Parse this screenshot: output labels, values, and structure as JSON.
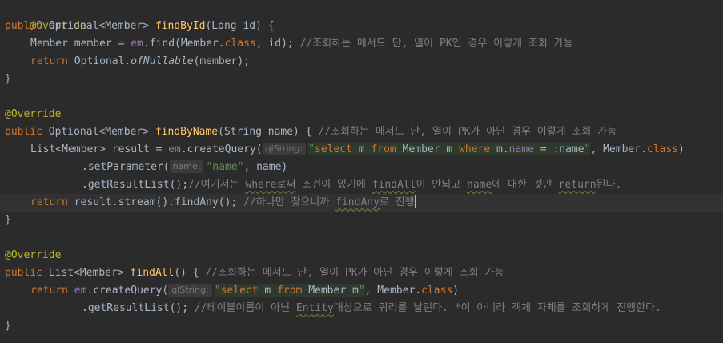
{
  "code": {
    "l1": {
      "ann": "@Override"
    },
    "l2": {
      "public": "public",
      "type": "Optional<Member>",
      "fn": "findById",
      "params": "(Long id) {"
    },
    "l3": {
      "t1": "Member member = ",
      "em": "em",
      "t2": ".find(Member.",
      "cls": "class",
      "t3": ", id);",
      "comment": " //조회하는 메서드 단, 열이 PK인 경우 이렇게 조회 가능"
    },
    "l4": {
      "ret": "return",
      "t1": " Optional.",
      "method": "ofNullable",
      "t2": "(member);"
    },
    "l5": {
      "t": "}"
    },
    "l7": {
      "ann": "@Override"
    },
    "l8": {
      "public": "public",
      "type": "Optional<Member>",
      "fn": "findByName",
      "params": "(String name) {",
      "comment": " //조회하는 메서드 단, 열이 PK가 아닌 경우 이렇게 조회 가능"
    },
    "l9": {
      "t1": "List<Member> result = ",
      "em": "em",
      "t2": ".createQuery(",
      "hint": "qlString:",
      "q1": "\"",
      "select": "select",
      "m1": " m ",
      "from": "from",
      "m2": " Member m ",
      "where": "where",
      "m3": " m.",
      "name": "name",
      "m4": " = :name",
      "q2": "\"",
      "t3": ", Member.",
      "cls": "class",
      "t4": ")"
    },
    "l10": {
      "t1": ".setParameter(",
      "hint": "name:",
      "str": "\"name\"",
      "t2": ", name)"
    },
    "l11": {
      "t1": ".getResultList();",
      "c1": "//여기서는 ",
      "w1": "where로써",
      "c2": " 조건이 있기에 ",
      "w2": "findAll",
      "c3": "이 안되고 ",
      "w3": "name",
      "c4": "에 대한 것만 ",
      "w4": "return",
      "c5": "된다."
    },
    "l12": {
      "ret": "return",
      "t1": " result.stream().findAny();",
      "comment": " //하나만 찾으니까 ",
      "w1": "findAny",
      "c2": "로 진행"
    },
    "l13": {
      "t": "}"
    },
    "l15": {
      "ann": "@Override"
    },
    "l16": {
      "public": "public",
      "type": "List<Member>",
      "fn": "findAll",
      "params": "() {",
      "comment": " //조회하는 메서드 단, 열이 PK가 아닌 경우 이렇게 조회 가능"
    },
    "l17": {
      "ret": "return",
      "t0": " ",
      "em": "em",
      "t1": ".createQuery(",
      "hint": "qlString:",
      "q1": "\"",
      "select": "select",
      "m1": " m ",
      "from": "from",
      "m2": " Member m",
      "q2": "\"",
      "t2": ", Member.",
      "cls": "class",
      "t3": ")"
    },
    "l18": {
      "t1": ".getResultList();",
      "c1": " //테이블이름이 아닌 ",
      "w1": "Entity",
      "c2": "대상으로 쿼리를 날린다. *이 아니라 객체 자체를 조회하게 진행한다."
    },
    "l19": {
      "t": "}"
    }
  },
  "colors": {
    "background": "#2b2b2b",
    "keyword": "#cc7832",
    "annotation": "#bbb529",
    "method": "#ffc66d",
    "field": "#9876aa",
    "string": "#6a8759",
    "comment": "#808080",
    "text": "#a9b7c6"
  }
}
